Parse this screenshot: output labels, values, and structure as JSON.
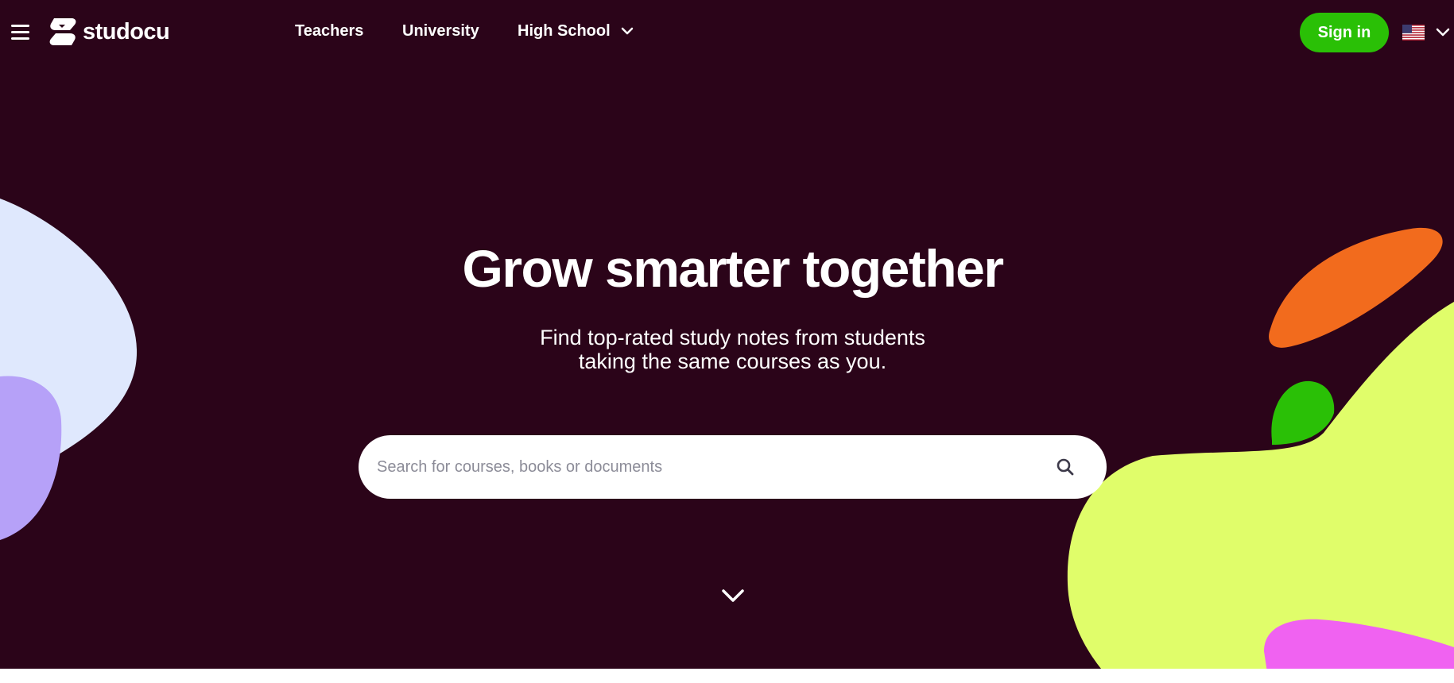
{
  "brand": {
    "name": "studocu"
  },
  "nav": {
    "items": [
      {
        "label": "Teachers"
      },
      {
        "label": "University"
      },
      {
        "label": "High School",
        "has_dropdown": true
      }
    ]
  },
  "header": {
    "sign_in_label": "Sign in",
    "locale_flag": "us-flag-icon"
  },
  "hero": {
    "title": "Grow smarter together",
    "subtitle_line1": "Find top-rated study notes from students",
    "subtitle_line2": "taking the same courses as you."
  },
  "search": {
    "placeholder": "Search for courses, books or documents",
    "value": ""
  },
  "colors": {
    "background": "#2b0419",
    "accent_green": "#2ac006",
    "blob_light_blue": "#dfe8fd",
    "blob_lavender": "#b6a1f8",
    "blob_orange": "#f26b1d",
    "blob_lime": "#e0fd6a",
    "blob_pink": "#f062f1",
    "blob_green": "#2ac006"
  }
}
